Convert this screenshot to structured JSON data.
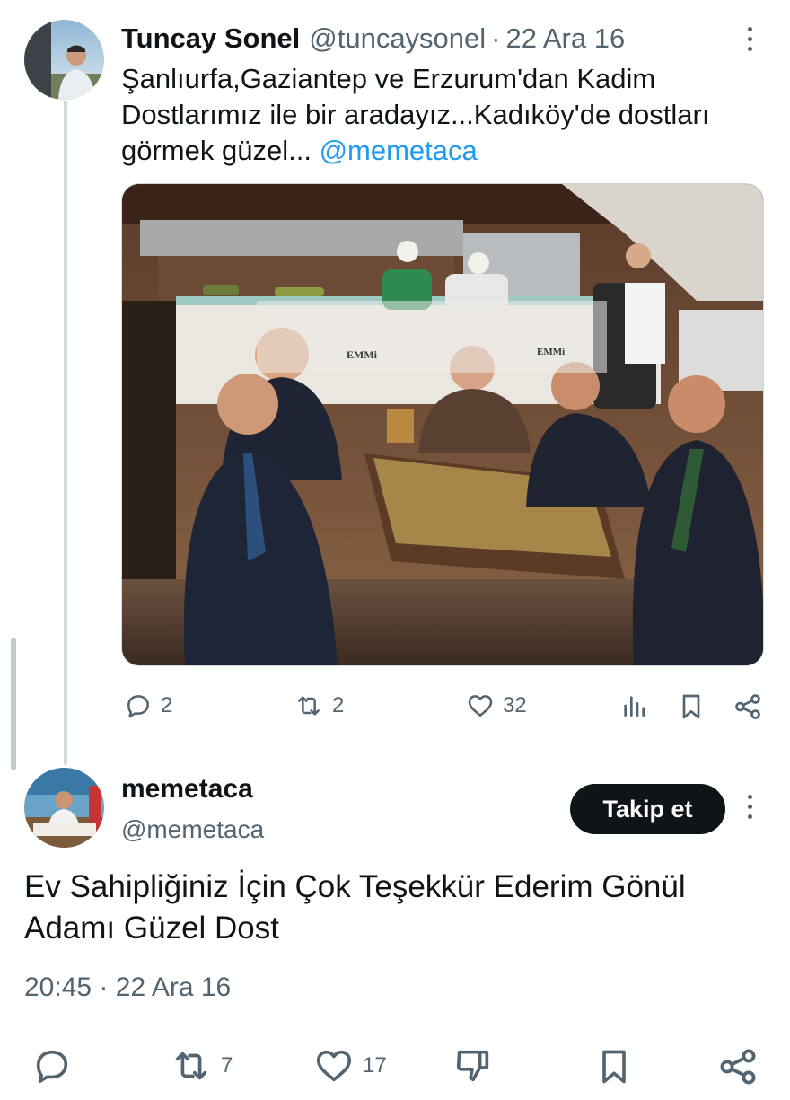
{
  "tweet1": {
    "author_name": "Tuncay Sonel",
    "handle": "@tuncaysonel",
    "separator": "·",
    "date": "22 Ara 16",
    "text": "Şanlıurfa,Gaziantep ve Erzurum'dan Kadim Dostlarımız ile bir aradayız...Kadıköy'de dostları görmek güzel...",
    "mention": "@memetaca",
    "media_sign_left": "EMMi",
    "media_sign_right": "EMMi",
    "stats": {
      "replies": "2",
      "reposts": "2",
      "likes": "32"
    }
  },
  "tweet2": {
    "author_name": "memetaca",
    "handle": "@memetaca",
    "follow_label": "Takip et",
    "text": "Ev Sahipliğiniz İçin Çok Teşekkür Ederim Gönül Adamı Güzel Dost",
    "time": "20:45",
    "separator": "·",
    "date": "22 Ara 16",
    "stats": {
      "reposts": "7",
      "likes": "17"
    }
  },
  "icons": {
    "reply": "reply-icon",
    "repost": "repost-icon",
    "like": "heart-icon",
    "views": "analytics-icon",
    "bookmark": "bookmark-icon",
    "share": "share-icon",
    "dislike": "dislike-icon",
    "more": "more-vertical-icon"
  },
  "colors": {
    "accent": "#1d9bf0",
    "text_primary": "#0f1419",
    "text_secondary": "#536471",
    "follow_button_bg": "#0f1419",
    "thread_line": "#cfd9de"
  }
}
